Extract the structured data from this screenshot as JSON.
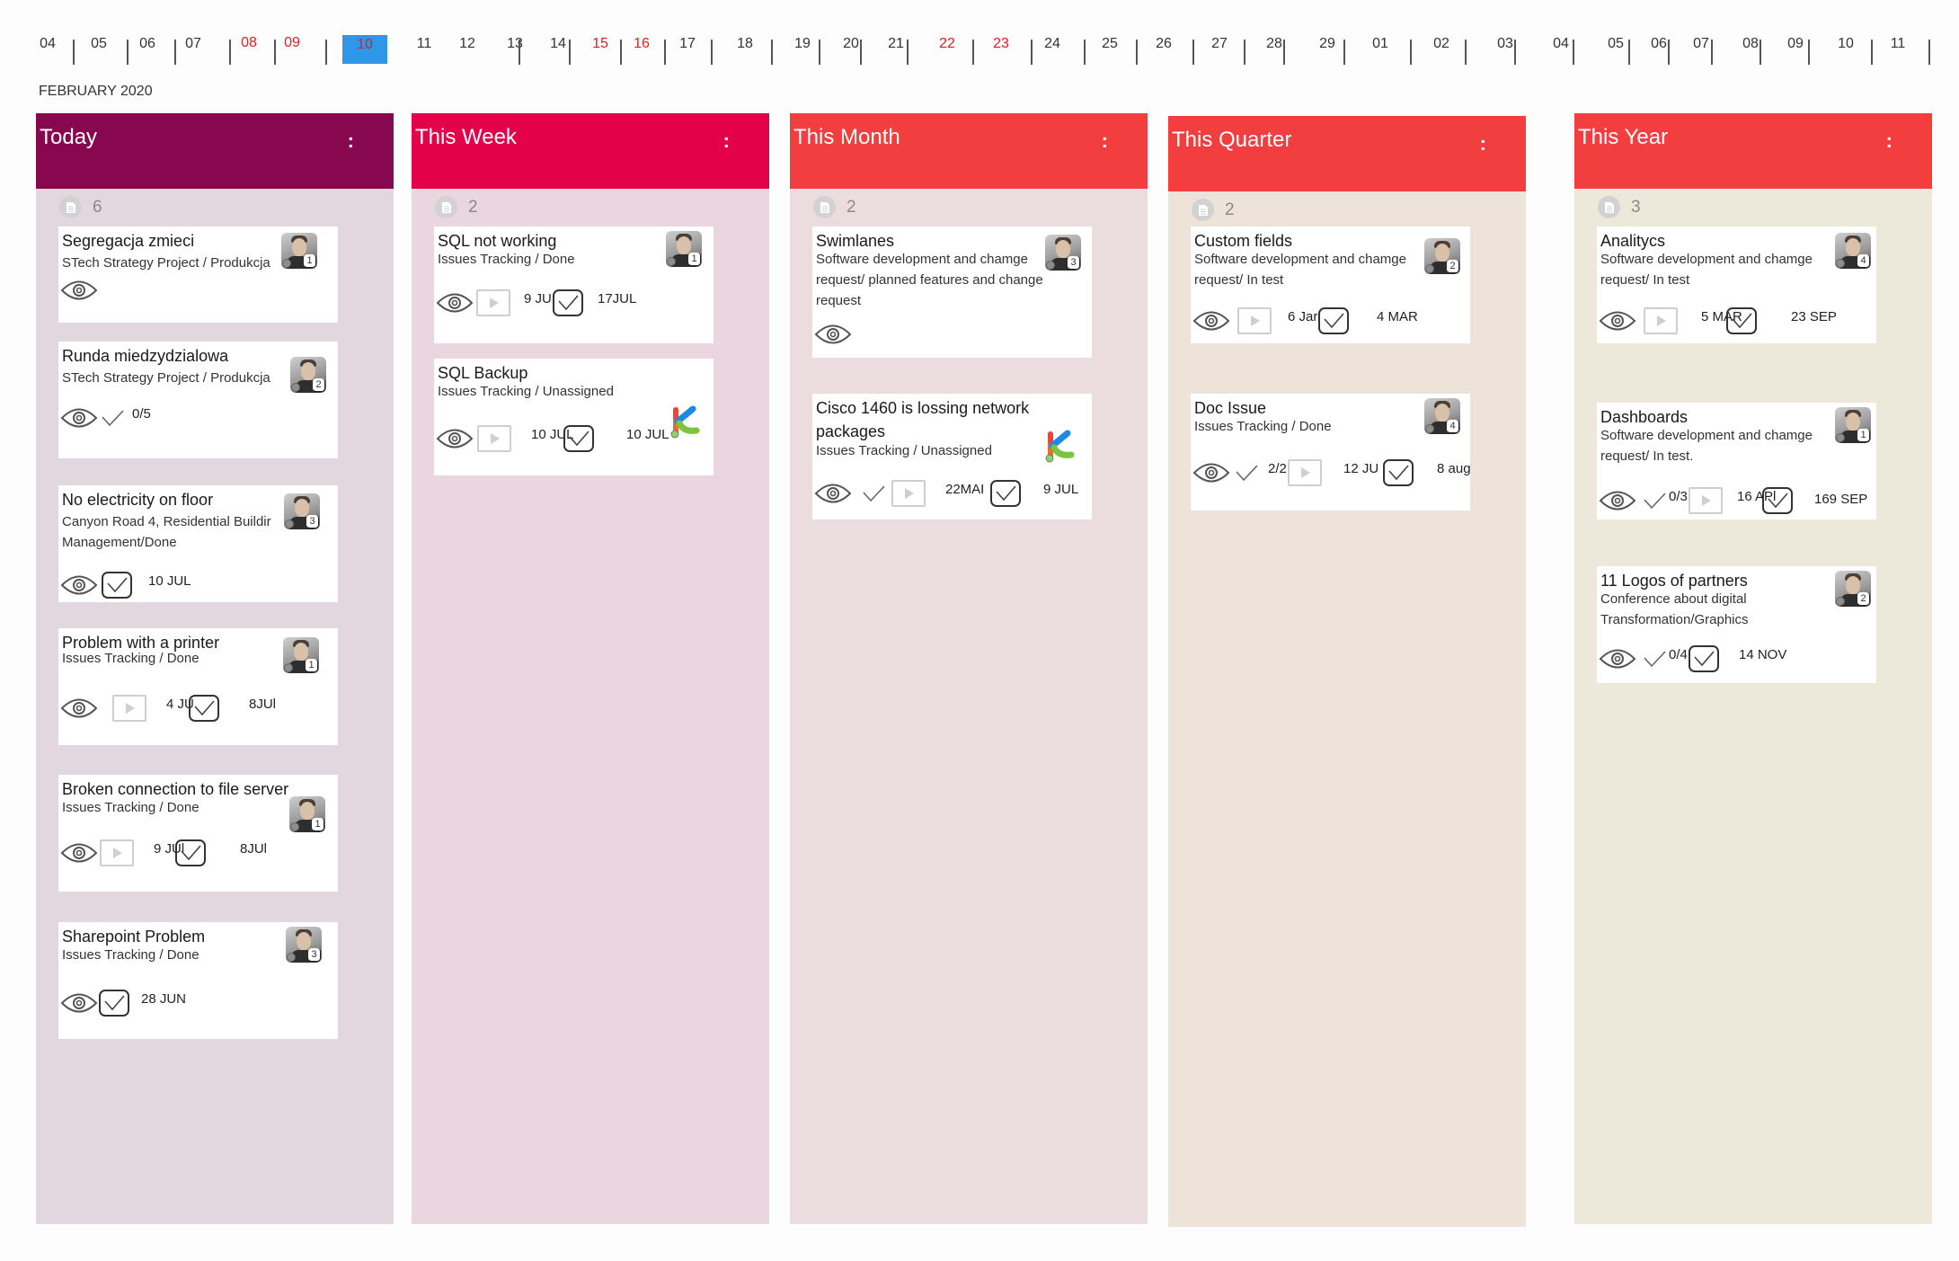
{
  "timeline": {
    "month_label": "FEBRUARY 2020",
    "days": [
      {
        "label": "04",
        "type": "normal"
      },
      {
        "label": "05",
        "type": "normal"
      },
      {
        "label": "06",
        "type": "normal"
      },
      {
        "label": "07",
        "type": "normal"
      },
      {
        "label": "08",
        "type": "weekend"
      },
      {
        "label": "09",
        "type": "weekend"
      },
      {
        "label": "10",
        "type": "today"
      },
      {
        "label": "11",
        "type": "normal"
      },
      {
        "label": "12",
        "type": "normal"
      },
      {
        "label": "13",
        "type": "normal"
      },
      {
        "label": "14",
        "type": "normal"
      },
      {
        "label": "15",
        "type": "weekend"
      },
      {
        "label": "16",
        "type": "weekend"
      },
      {
        "label": "17",
        "type": "normal"
      },
      {
        "label": "18",
        "type": "normal"
      },
      {
        "label": "19",
        "type": "normal"
      },
      {
        "label": "20",
        "type": "normal"
      },
      {
        "label": "21",
        "type": "normal"
      },
      {
        "label": "22",
        "type": "weekend"
      },
      {
        "label": "23",
        "type": "weekend"
      },
      {
        "label": "24",
        "type": "normal"
      },
      {
        "label": "25",
        "type": "normal"
      },
      {
        "label": "26",
        "type": "normal"
      },
      {
        "label": "27",
        "type": "normal"
      },
      {
        "label": "28",
        "type": "normal"
      },
      {
        "label": "29",
        "type": "normal"
      },
      {
        "label": "01",
        "type": "normal"
      },
      {
        "label": "02",
        "type": "normal"
      },
      {
        "label": "03",
        "type": "normal"
      },
      {
        "label": "04",
        "type": "normal"
      },
      {
        "label": "05",
        "type": "normal"
      },
      {
        "label": "06",
        "type": "normal"
      },
      {
        "label": "07",
        "type": "normal"
      },
      {
        "label": "08",
        "type": "normal"
      },
      {
        "label": "09",
        "type": "normal"
      },
      {
        "label": "10",
        "type": "normal"
      },
      {
        "label": "11",
        "type": "normal"
      }
    ],
    "colors": {
      "weekend": "#e31b23",
      "today_bg": "#2f97ea"
    }
  },
  "columns": [
    {
      "title": "Today",
      "menu_icon": "vertical-dots-icon",
      "count": "6",
      "header_color": "#87084f",
      "body_color": "#e2d7df",
      "cards": [
        {
          "title": "Segregacja zmieci",
          "subtitle": "STech Strategy Project / Produkcja",
          "avatar_badge": "1",
          "assignee": "avatar",
          "footer": [
            {
              "icon": "eye-icon"
            }
          ]
        },
        {
          "title": "Runda miedzydzialowa",
          "subtitle": "STech Strategy Project / Produkcja",
          "avatar_badge": "2",
          "assignee": "avatar",
          "footer": [
            {
              "icon": "eye-icon"
            },
            {
              "icon": "checklist-icon"
            },
            {
              "text": "0/5"
            }
          ]
        },
        {
          "title": "No electricity on floor",
          "subtitle": "Canyon Road 4, Residential Buildir Management/Done",
          "avatar_badge": "3",
          "assignee": "avatar",
          "footer": [
            {
              "icon": "eye-icon"
            },
            {
              "icon": "due-date-check-icon"
            },
            {
              "text": "10 JUL"
            }
          ]
        },
        {
          "title": "Problem with a printer",
          "subtitle": "Issues Tracking / Done",
          "avatar_badge": "1",
          "assignee": "avatar",
          "footer": [
            {
              "icon": "eye-icon"
            },
            {
              "icon": "start-date-play-icon"
            },
            {
              "text": "4 JU"
            },
            {
              "icon": "due-date-check-icon"
            },
            {
              "text": "8JUl"
            }
          ]
        },
        {
          "title": "Broken connection to file server",
          "subtitle": "Issues Tracking / Done",
          "avatar_badge": "1",
          "assignee": "avatar",
          "footer": [
            {
              "icon": "eye-icon"
            },
            {
              "icon": "start-date-play-icon"
            },
            {
              "text": "9 JUl"
            },
            {
              "icon": "due-date-check-icon"
            },
            {
              "text": "8JUl"
            }
          ]
        },
        {
          "title": "Sharepoint Problem",
          "subtitle": "Issues Tracking / Done",
          "avatar_badge": "3",
          "assignee": "avatar",
          "footer": [
            {
              "icon": "eye-icon"
            },
            {
              "icon": "due-date-check-icon"
            },
            {
              "text": "28 JUN"
            }
          ]
        }
      ]
    },
    {
      "title": "This Week",
      "menu_icon": "vertical-dots-icon",
      "count": "2",
      "header_color": "#e4004b",
      "body_color": "#ead6df",
      "cards": [
        {
          "title": "SQL not working",
          "subtitle": "Issues Tracking / Done",
          "avatar_badge": "1",
          "assignee": "avatar",
          "footer": [
            {
              "icon": "eye-icon"
            },
            {
              "icon": "start-date-play-icon"
            },
            {
              "text": "9 JU"
            },
            {
              "icon": "due-date-check-icon"
            },
            {
              "text": "17JUL"
            }
          ]
        },
        {
          "title": "SQL Backup",
          "subtitle": "Issues Tracking / Unassigned",
          "assignee": "k-logo",
          "footer": [
            {
              "icon": "eye-icon"
            },
            {
              "icon": "start-date-play-icon"
            },
            {
              "text": "10 JUL"
            },
            {
              "icon": "due-date-check-icon"
            },
            {
              "text": "10 JUL"
            }
          ]
        }
      ]
    },
    {
      "title": "This Month",
      "menu_icon": "vertical-dots-icon",
      "count": "2",
      "header_color": "#f23e3e",
      "body_color": "#ebdddf",
      "cards": [
        {
          "title": "Swimlanes",
          "subtitle": "Software development and chamge request/ planned features and change request",
          "avatar_badge": "3",
          "assignee": "avatar",
          "footer": [
            {
              "icon": "eye-icon"
            }
          ]
        },
        {
          "title": "Cisco 1460 is lossing network packages",
          "subtitle": "Issues Tracking / Unassigned",
          "assignee": "k-logo",
          "footer": [
            {
              "icon": "eye-icon"
            },
            {
              "icon": "checklist-icon"
            },
            {
              "icon": "start-date-play-icon"
            },
            {
              "text": "22MAI"
            },
            {
              "icon": "due-date-check-icon"
            },
            {
              "text": "9 JUL"
            }
          ]
        }
      ]
    },
    {
      "title": "This Quarter",
      "menu_icon": "vertical-dots-icon",
      "count": "2",
      "header_color": "#f23e3e",
      "body_color": "#eee3d9",
      "cards": [
        {
          "title": "Custom fields",
          "subtitle": "Software development and chamge request/   In test",
          "avatar_badge": "2",
          "assignee": "avatar",
          "footer": [
            {
              "icon": "eye-icon"
            },
            {
              "icon": "start-date-play-icon"
            },
            {
              "text": "6 Jar"
            },
            {
              "icon": "due-date-check-icon"
            },
            {
              "text": "4 MAR"
            }
          ]
        },
        {
          "title": "Doc Issue",
          "subtitle": "Issues Tracking / Done",
          "avatar_badge": "4",
          "assignee": "avatar",
          "footer": [
            {
              "icon": "eye-icon"
            },
            {
              "icon": "checklist-icon"
            },
            {
              "text": "2/2"
            },
            {
              "icon": "start-date-play-icon"
            },
            {
              "text": "12 JU"
            },
            {
              "icon": "due-date-check-icon"
            },
            {
              "text": "8 aug"
            }
          ]
        }
      ]
    },
    {
      "title": "This Year",
      "menu_icon": "vertical-dots-icon",
      "count": "3",
      "header_color": "#f23e3e",
      "body_color": "#ece8da",
      "cards": [
        {
          "title": "Analitycs",
          "subtitle": "Software development and chamge request/   In test",
          "avatar_badge": "4",
          "assignee": "avatar",
          "footer": [
            {
              "icon": "eye-icon"
            },
            {
              "icon": "start-date-play-icon"
            },
            {
              "text": "5 MAR"
            },
            {
              "icon": "due-date-check-icon"
            },
            {
              "text": "23 SEP"
            }
          ]
        },
        {
          "title": "Dashboards",
          "subtitle": "Software development and chamge request/ In test.",
          "avatar_badge": "1",
          "assignee": "avatar",
          "footer": [
            {
              "icon": "eye-icon"
            },
            {
              "icon": "checklist-icon"
            },
            {
              "text": "0/3"
            },
            {
              "icon": "start-date-play-icon"
            },
            {
              "text": "16 APl"
            },
            {
              "icon": "due-date-check-icon"
            },
            {
              "text": "169 SEP"
            }
          ]
        },
        {
          "title": "11 Logos of partners",
          "subtitle": "Conference about digital Transformation/Graphics",
          "avatar_badge": "2",
          "assignee": "avatar",
          "footer": [
            {
              "icon": "eye-icon"
            },
            {
              "icon": "checklist-icon"
            },
            {
              "text": "0/4"
            },
            {
              "icon": "due-date-check-icon"
            },
            {
              "text": "14 NOV"
            }
          ]
        }
      ]
    }
  ]
}
